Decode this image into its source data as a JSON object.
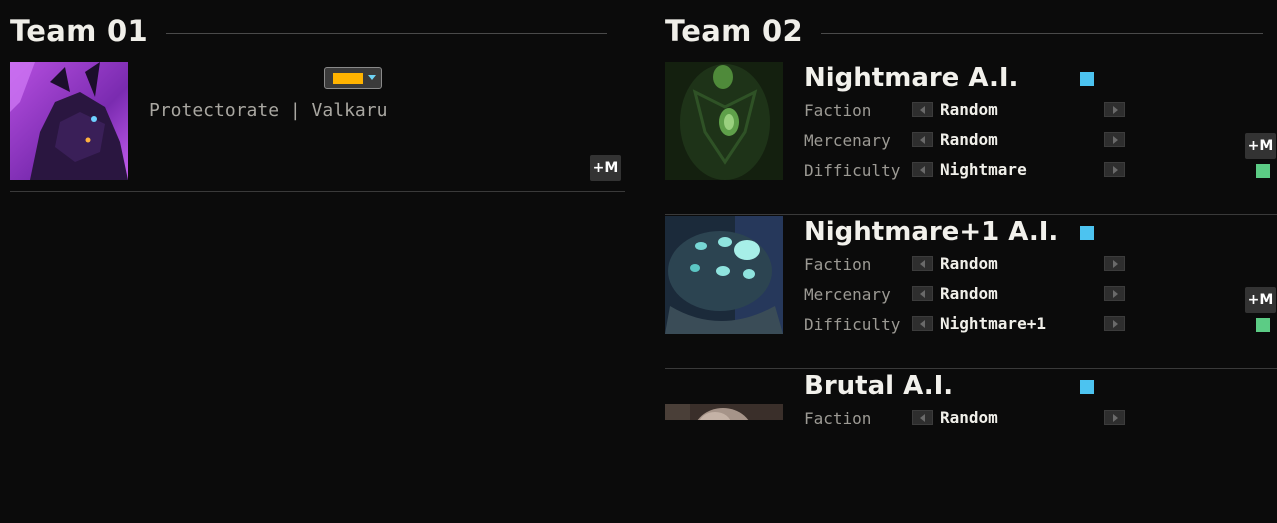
{
  "team1": {
    "title": "Team 01",
    "players": [
      {
        "faction_text": "Protectorate | Valkaru",
        "color": "#ffb300",
        "mute_label": "+M",
        "portrait_icon": "valkaru-portrait"
      }
    ]
  },
  "team2": {
    "title": "Team 02",
    "ai_players": [
      {
        "name": "Nightmare A.I.",
        "color": "#4cc3f0",
        "faction_label": "Faction",
        "faction_value": "Random",
        "mercenary_label": "Mercenary",
        "mercenary_value": "Random",
        "difficulty_label": "Difficulty",
        "difficulty_value": "Nightmare",
        "mute_label": "+M",
        "ready_color": "#5ccc85",
        "portrait_icon": "green-crystal-portrait"
      },
      {
        "name": "Nightmare+1 A.I.",
        "color": "#4cc3f0",
        "faction_label": "Faction",
        "faction_value": "Random",
        "mercenary_label": "Mercenary",
        "mercenary_value": "Random",
        "difficulty_label": "Difficulty",
        "difficulty_value": "Nightmare+1",
        "mute_label": "+M",
        "ready_color": "#5ccc85",
        "portrait_icon": "blue-pod-portrait"
      },
      {
        "name": "Brutal A.I.",
        "color": "#4cc3f0",
        "faction_label": "Faction",
        "faction_value": "Random",
        "portrait_icon": "brutal-portrait"
      }
    ]
  }
}
